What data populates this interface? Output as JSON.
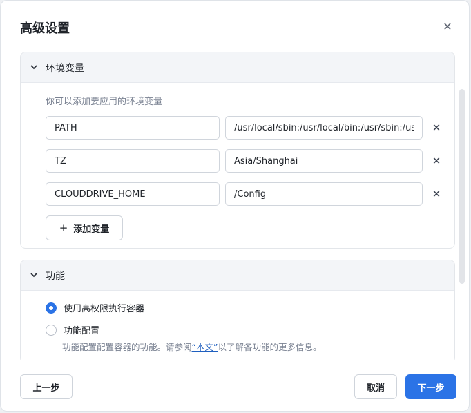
{
  "dialog": {
    "title": "高级设置"
  },
  "env_section": {
    "title": "环境变量",
    "hint": "你可以添加要应用的环境变量",
    "rows": [
      {
        "key": "PATH",
        "value": "/usr/local/sbin:/usr/local/bin:/usr/sbin:/usr"
      },
      {
        "key": "TZ",
        "value": "Asia/Shanghai"
      },
      {
        "key": "CLOUDDRIVE_HOME",
        "value": "/Config"
      }
    ],
    "add_label": "添加变量"
  },
  "feature_section": {
    "title": "功能",
    "option_privileged": "使用高权限执行容器",
    "option_capabilities": "功能配置",
    "desc_before": "功能配置配置容器的功能。请参阅",
    "desc_link": "“本文”",
    "desc_after": "以了解各功能的更多信息。",
    "selected": "option_privileged"
  },
  "footer": {
    "prev_label": "上一步",
    "cancel_label": "取消",
    "next_label": "下一步"
  },
  "colors": {
    "primary": "#2b73e6",
    "header_bg": "#f3f5f8"
  }
}
